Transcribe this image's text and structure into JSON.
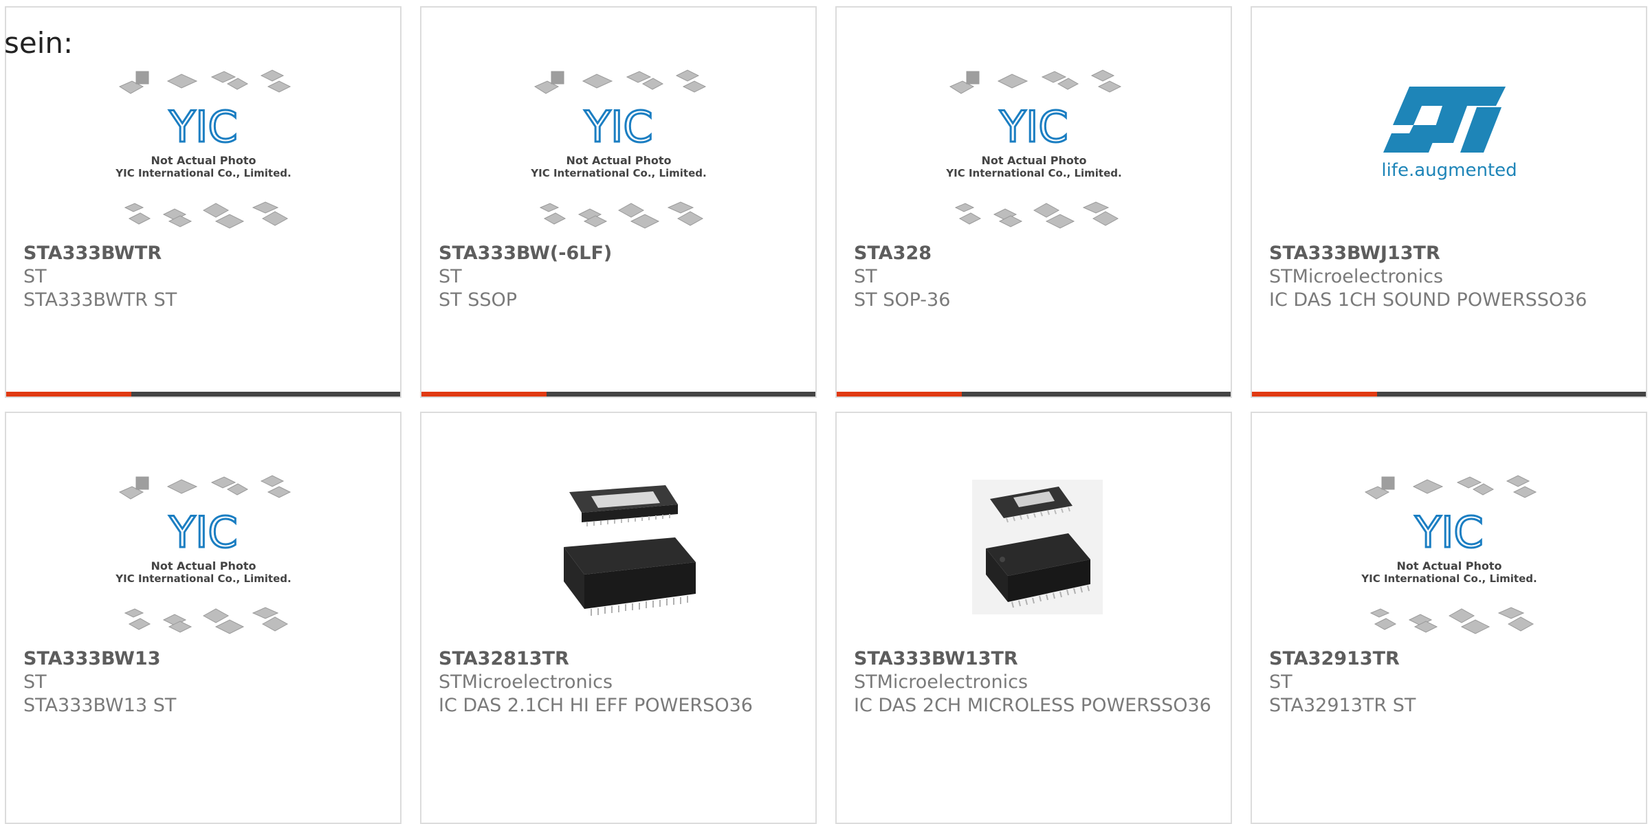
{
  "intro_text": "sein:",
  "placeholder": {
    "line1": "Not Actual Photo",
    "line2": "YIC International Co., Limited.",
    "logo_text": "YIC"
  },
  "st_logo": {
    "tagline": "life.augmented",
    "color": "#1e85b8"
  },
  "colors": {
    "accent": "#e03a12",
    "bar": "#444444",
    "card_border": "#dcdcdc"
  },
  "products": [
    {
      "part": "STA333BWTR",
      "mfr": "ST",
      "desc": "STA333BWTR ST",
      "image": "placeholder-photo"
    },
    {
      "part": "STA333BW(-6LF)",
      "mfr": "ST",
      "desc": "ST SSOP",
      "image": "placeholder-photo"
    },
    {
      "part": "STA328",
      "mfr": "ST",
      "desc": "ST SOP-36",
      "image": "placeholder-photo"
    },
    {
      "part": "STA333BWJ13TR",
      "mfr": "STMicroelectronics",
      "desc": "IC DAS 1CH SOUND POWERSSO36",
      "image": "st-logo"
    },
    {
      "part": "STA333BW13",
      "mfr": "ST",
      "desc": "STA333BW13 ST",
      "image": "placeholder-photo"
    },
    {
      "part": "STA32813TR",
      "mfr": "STMicroelectronics",
      "desc": "IC DAS 2.1CH HI EFF POWERSO36",
      "image": "chip-photo"
    },
    {
      "part": "STA333BW13TR",
      "mfr": "STMicroelectronics",
      "desc": "IC DAS 2CH MICROLESS POWERSSO36",
      "image": "chip-photo"
    },
    {
      "part": "STA32913TR",
      "mfr": "ST",
      "desc": "STA32913TR ST",
      "image": "placeholder-photo"
    }
  ]
}
